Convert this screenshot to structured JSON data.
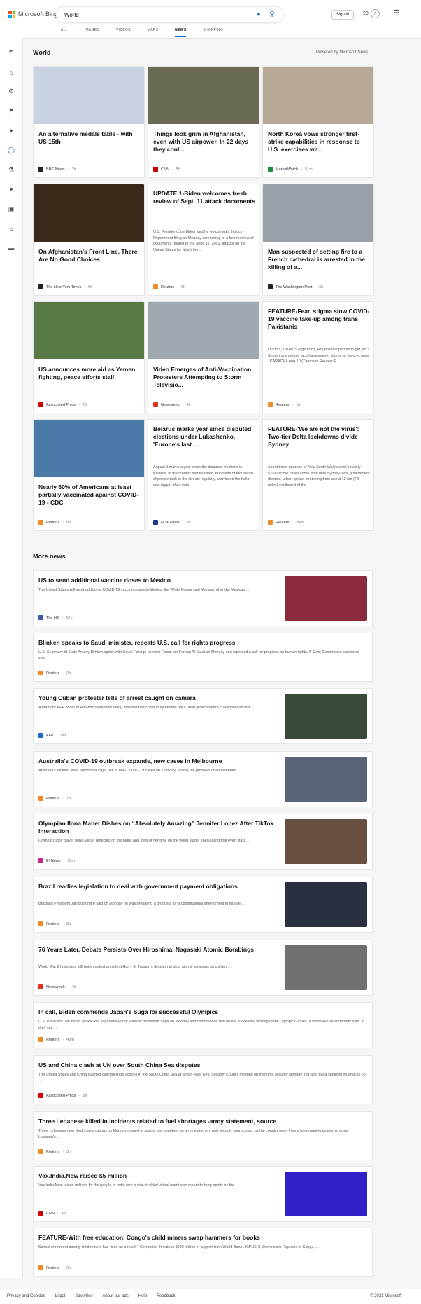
{
  "header": {
    "logo_text": "Microsoft Bing",
    "search_value": "World",
    "signin_label": "Sign in",
    "rewards_count": "20",
    "tabs": [
      {
        "label": "ALL"
      },
      {
        "label": "IMAGES"
      },
      {
        "label": "VIDEOS"
      },
      {
        "label": "MAPS"
      },
      {
        "label": "NEWS"
      },
      {
        "label": "SHOPPING"
      }
    ],
    "active_tab": "NEWS"
  },
  "colors": {
    "accent": "#0f6cbd",
    "logo": [
      "#f25022",
      "#7fba00",
      "#00a4ef",
      "#ffb900"
    ]
  },
  "sidebar": {
    "icons": [
      "chevron-right-icon",
      "home-icon",
      "tools-icon",
      "flag-icon",
      "location-pin-icon",
      "globe-icon",
      "science-icon",
      "rocket-icon",
      "film-icon",
      "bank-icon",
      "card-icon"
    ]
  },
  "world": {
    "title": "World",
    "powered": "Powered by Microsoft News",
    "cards": [
      {
        "title": "An alternative medals table - with US 15th",
        "source": "BBC News",
        "time": "1h",
        "logo": "B",
        "logo_color": "#222"
      },
      {
        "title": "Things look grim in Afghanistan, even with US airpower. In 22 days they coul...",
        "source": "CNN",
        "time": "5h",
        "logo": "C",
        "logo_color": "#cc0000"
      },
      {
        "title": "North Korea vows stronger first-strike capabilities in response to U.S. exercises wit...",
        "source": "MarketWatch",
        "time": "51m",
        "logo": "M",
        "logo_color": "#1a8a3a"
      },
      {
        "title": "On Afghanistan's Front Line, There Are No Good Choices",
        "source": "The New York Times",
        "time": "5h",
        "logo": "T",
        "logo_color": "#222"
      },
      {
        "title": "UPDATE 1-Biden welcomes fresh review of Sept. 11 attack documents",
        "snippet": "U.S. President Joe Biden said he welcomed a Justice Department filing on Monday committing to a fresh review of documents related to the Sept. 11, 2001, attacks on the United States for which the ...",
        "source": "Reuters",
        "time": "6h",
        "logo": "R",
        "logo_color": "#f08c28"
      },
      {
        "title": "Man suspected of setting fire to a French cathedral is arrested in the killing of a...",
        "source": "The Washington Post",
        "time": "6h",
        "logo": "W",
        "logo_color": "#222"
      },
      {
        "title": "US announces more aid as Yemen fighting, peace efforts stall",
        "source": "Associated Press",
        "time": "7h",
        "logo": "AP",
        "logo_color": "#cc0000"
      },
      {
        "title": "Video Emerges of Anti-Vaccination Protesters Attempting to Storm Televisio...",
        "source": "Newsweek",
        "time": "8h",
        "logo": "N",
        "logo_color": "#e0301e"
      },
      {
        "title": "FEATURE-Fear, stigma slow COVID-19 vaccine take-up among trans Pakistanis",
        "snippet": "Doctors, UNAIDS urge trans, HIV-positive people to get jab * Some trans people face harassment, stigma at vaccine units . KARACHI, Aug 10 (Thomson Reuters F ...",
        "source": "Reuters",
        "time": "1h",
        "logo": "R",
        "logo_color": "#f08c28"
      },
      {
        "title": "Nearly 60% of Americans at least partially vaccinated against COVID-19 - CDC",
        "source": "Reuters",
        "time": "5h",
        "logo": "R",
        "logo_color": "#f08c28"
      },
      {
        "title": "Belarus marks year since disputed elections under Lukashenko, 'Europe's last...",
        "snippet": "August 9 marks a year since the disputed elections in Belarus. In the months that followed, hundreds of thousands of people took to the streets regularly, convinced the ballot was rigged, their vote ...",
        "source": "FOX News",
        "time": "2h",
        "logo": "F",
        "logo_color": "#1a3a8a"
      },
      {
        "title": "FEATURE-'We are not the virus': Two-tier Delta lockdowns divide Sydney",
        "snippet": "About three-quarters of New South Wales state's nearly 5,000 active cases come from nine Sydney local government districts, urban sprawl stretching from about 12 km (7.5 miles) southwest of the ...",
        "source": "Reuters",
        "time": "26m",
        "logo": "R",
        "logo_color": "#f08c28"
      }
    ]
  },
  "more_news": {
    "title": "More news",
    "items": [
      {
        "title": "US to send additional vaccine doses to Mexico",
        "snippet": "The United States will send additional COVID-19 vaccine doses to Mexico, the White House said Monday, after the Mexican ...",
        "source": "The Hill",
        "time": "52m",
        "logo": "H",
        "logo_color": "#3a5aa8",
        "thumb": "#8a2a3a"
      },
      {
        "title": "Blinken speaks to Saudi minister, repeats U.S. call for rights progress",
        "snippet": "U.S. Secretary of State Antony Blinken spoke with Saudi Foreign Minister Faisal bin Farhan Al Saud on Monday and repeated a call for progress on human rights. A State Department statement said ...",
        "source": "Reuters",
        "time": "2h",
        "logo": "R",
        "logo_color": "#f08c28",
        "thumb": ""
      },
      {
        "title": "Young Cuban protester tells of arrest caught on camera",
        "snippet": "A dramatic AFP photo of Rolando Remedios being arrested has come to symbolize the Cuban government's crackdown on last ...",
        "source": "AFP",
        "time": "8m",
        "logo": "A",
        "logo_color": "#1a6ac8",
        "thumb": "#3a4a3a"
      },
      {
        "title": "Australia's COVID-19 outbreak expands, new cases in Melbourne",
        "snippet": "Australia's Victoria state reported a slight rise in new COVID-19 cases on Tuesday, raising the prospect of an extended ...",
        "source": "Reuters",
        "time": "2h",
        "logo": "R",
        "logo_color": "#f08c28",
        "thumb": "#5a6478"
      },
      {
        "title": "Olympian Ilona Maher Dishes on “Absolutely Amazing” Jennifer Lopez After TikTok Interaction",
        "snippet": "Olympic rugby player Ilona Maher reflected on the highs and lows of her time on the world stage, speculating that even stars ...",
        "source": "E! News",
        "time": "58m",
        "logo": "E",
        "logo_color": "#c8288a",
        "thumb": "#6a5040"
      },
      {
        "title": "Brazil readies legislation to deal with government payment obligations",
        "snippet": "Brazilian President Jair Bolsonaro said on Monday he was preparing a proposal for a constitutional amendment to handle ...",
        "source": "Reuters",
        "time": "3h",
        "logo": "R",
        "logo_color": "#f08c28",
        "thumb": "#2a3040"
      },
      {
        "title": "76 Years Later, Debate Persists Over Hiroshima, Nagasaki Atomic Bombings",
        "snippet": "World War II historians still hotly contest president Harry S. Truman's decision to drop atomic weapons on civilian ...",
        "source": "Newsweek",
        "time": "4h",
        "logo": "N",
        "logo_color": "#e0301e",
        "thumb": "#707070"
      },
      {
        "title": "In call, Biden commends Japan's Suga for successful Olympics",
        "snippet": "U.S. President Joe Biden spoke with Japanese Prime Minister Yoshihide Suga on Monday and commended him on the successful hosting of the Olympic Games, a White House statement said. In their call, ...",
        "source": "Reuters",
        "time": "48m",
        "logo": "R",
        "logo_color": "#f08c28",
        "thumb": ""
      },
      {
        "title": "US and China clash at UN over South China Sea disputes",
        "snippet": "The United States and China clashed over Beijing's actions in the South China Sea at a high-level U.N. Security Council meeting on maritime security Monday that also put a spotlight on attacks on ...",
        "source": "Associated Press",
        "time": "5h",
        "logo": "AP",
        "logo_color": "#cc0000",
        "thumb": ""
      },
      {
        "title": "Three Lebanese killed in incidents related to fuel shortages -army statement, source",
        "snippet": "Three Lebanese men died in altercations on Monday related to scarce fuel supplies, an army statement and security source said, as the country reels from a long-running economic crisis. Lebanon's ...",
        "source": "Reuters",
        "time": "3h",
        "logo": "R",
        "logo_color": "#f08c28",
        "thumb": ""
      },
      {
        "title": "Vax.India.Now raised $5 million",
        "snippet": "Vax.India.Now raised millions for the people of India with a star-studded virtual event also meant to buoy spirits as the ...",
        "source": "CNN",
        "time": "4h",
        "logo": "C",
        "logo_color": "#cc0000",
        "thumb": "#3020c8"
      },
      {
        "title": "FEATURE-With free education, Congo's child miners swap hammers for books",
        "snippet": "School enrolment among child miners has risen as a result * Corruption threatens $800 million in support from World Bank . KIPUSHI, Democratic Republic of Congo, ...",
        "source": "Reuters",
        "time": "2h",
        "logo": "R",
        "logo_color": "#f08c28",
        "thumb": ""
      }
    ]
  },
  "footer": {
    "links": [
      {
        "label": "Privacy and Cookies"
      },
      {
        "label": "Legal"
      },
      {
        "label": "Advertise"
      },
      {
        "label": "About our ads"
      },
      {
        "label": "Help"
      },
      {
        "label": "Feedback"
      }
    ],
    "copyright": "© 2021 Microsoft"
  }
}
